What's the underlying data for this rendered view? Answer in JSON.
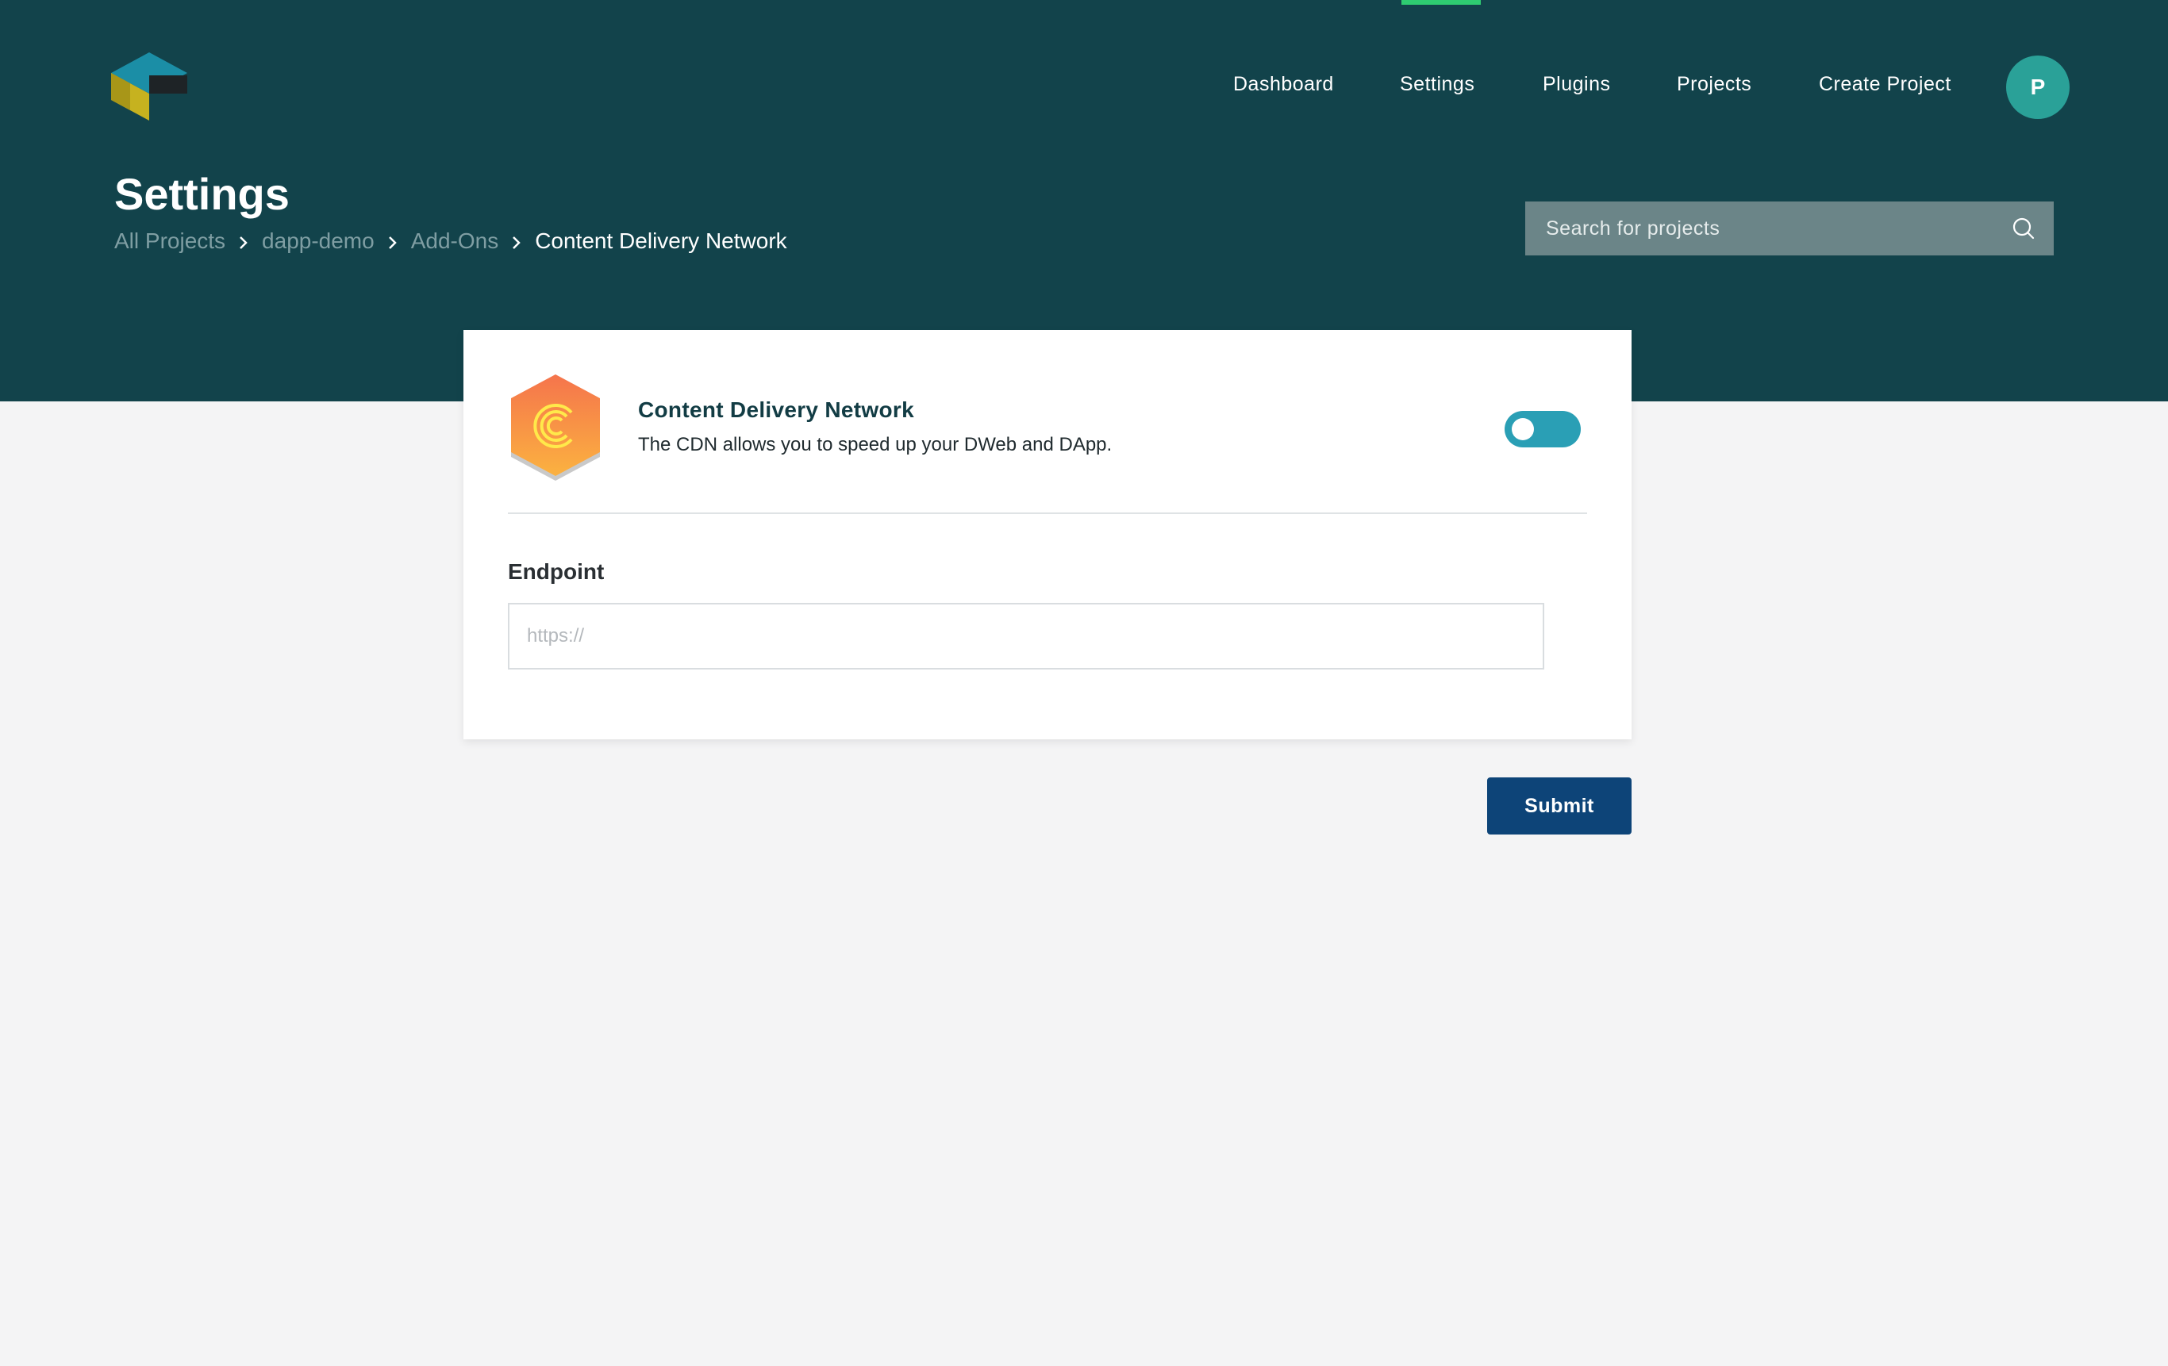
{
  "nav": {
    "items": [
      {
        "label": "Dashboard"
      },
      {
        "label": "Settings"
      },
      {
        "label": "Plugins"
      },
      {
        "label": "Projects"
      },
      {
        "label": "Create Project"
      }
    ],
    "active": "Settings",
    "avatar_initial": "P"
  },
  "header": {
    "title": "Settings",
    "breadcrumb": [
      {
        "label": "All Projects"
      },
      {
        "label": "dapp-demo"
      },
      {
        "label": "Add-Ons"
      },
      {
        "label": "Content Delivery Network"
      }
    ]
  },
  "search": {
    "placeholder": "Search for projects",
    "value": ""
  },
  "addon": {
    "name": "Content Delivery Network",
    "description": "The CDN allows you to speed up your DWeb and DApp.",
    "icon": "cdn-logo-icon",
    "enabled": false
  },
  "endpoint": {
    "label": "Endpoint",
    "placeholder": "https://",
    "value": ""
  },
  "actions": {
    "submit_label": "Submit"
  },
  "colors": {
    "header_bg": "#12434b",
    "page_bg": "#f4f4f5",
    "nav_active_indicator": "#2ecc71",
    "avatar_bg": "#2aa198",
    "toggle_bg": "#2a9fb5",
    "submit_bg": "#0d4478",
    "search_bg": "#6b8588"
  }
}
